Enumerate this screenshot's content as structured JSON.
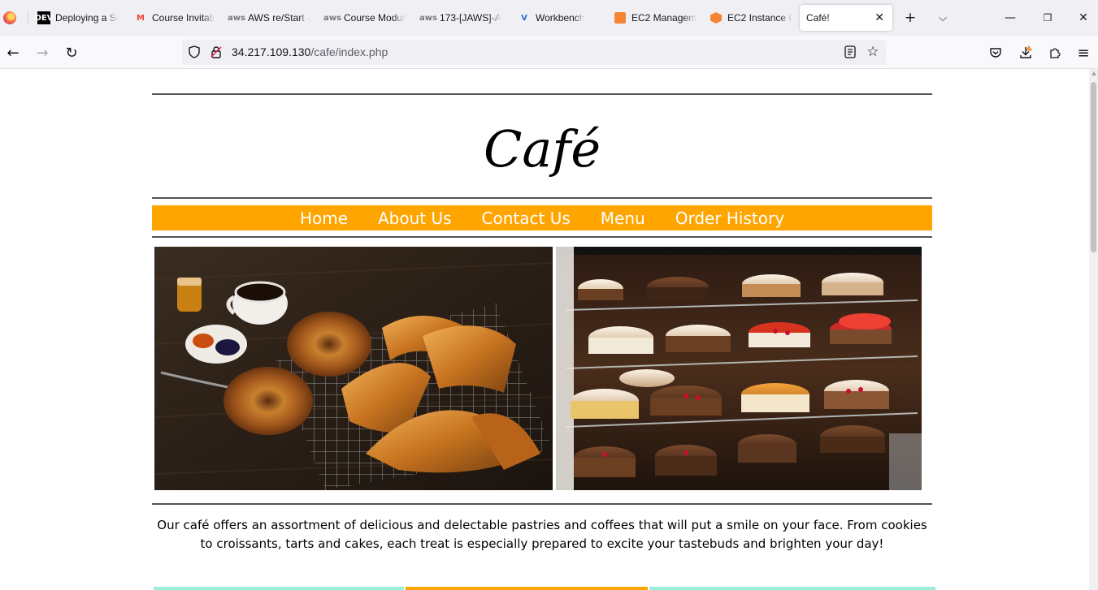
{
  "browser": {
    "tabs": [
      {
        "title": "Deploying a Si",
        "favicon": "dev-icon",
        "active": false
      },
      {
        "title": "Course Invitati",
        "favicon": "gmail-icon",
        "active": false
      },
      {
        "title": "AWS re/Start -",
        "favicon": "aws-icon",
        "active": false
      },
      {
        "title": "Course Modul",
        "favicon": "aws-icon",
        "active": false
      },
      {
        "title": "173-[JAWS]-A",
        "favicon": "aws-icon",
        "active": false
      },
      {
        "title": "Workbench",
        "favicon": "vocareum-icon",
        "active": false
      },
      {
        "title": "EC2 Managem",
        "favicon": "ec2-icon",
        "active": false
      },
      {
        "title": "EC2 Instance C",
        "favicon": "ec2-hex-icon",
        "active": false
      },
      {
        "title": "Café!",
        "favicon": "",
        "active": true
      }
    ],
    "url_host": "34.217.109.130",
    "url_path": "/cafe/index.php"
  },
  "site": {
    "title": "Café",
    "nav": [
      "Home",
      "About Us",
      "Contact Us",
      "Menu",
      "Order History"
    ],
    "description": "Our café offers an assortment of delicious and delectable pastries and coffees that will put a smile on your face. From cookies to croissants, tarts and cakes, each treat is especially prepared to excite your tastebuds and brighten your day!",
    "images": [
      "pastries-photo",
      "cake-display-photo"
    ]
  },
  "colors": {
    "nav_bar": "#ffa500",
    "strip_left": "#99f0d8",
    "strip_middle": "#ffa500",
    "strip_right": "#99f0d8"
  }
}
